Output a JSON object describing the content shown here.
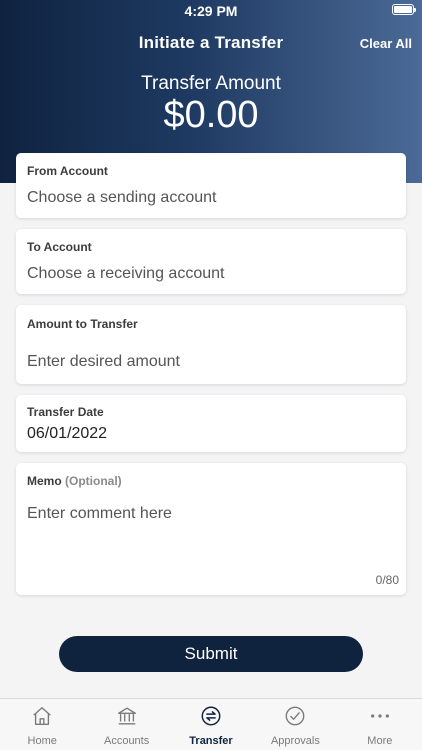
{
  "status_bar": {
    "time": "4:29 PM"
  },
  "header": {
    "title": "Initiate a Transfer",
    "clear_all": "Clear All",
    "amount_label": "Transfer Amount",
    "amount_value": "$0.00"
  },
  "form": {
    "from_account": {
      "label": "From Account",
      "placeholder": "Choose a sending account"
    },
    "to_account": {
      "label": "To Account",
      "placeholder": "Choose a receiving account"
    },
    "amount": {
      "label": "Amount to Transfer",
      "placeholder": "Enter desired amount"
    },
    "transfer_date": {
      "label": "Transfer Date",
      "value": "06/01/2022"
    },
    "memo": {
      "label": "Memo",
      "optional": "(Optional)",
      "placeholder": "Enter comment here",
      "counter": "0/80"
    },
    "submit_label": "Submit"
  },
  "tabbar": {
    "items": [
      {
        "label": "Home",
        "icon": "home-icon"
      },
      {
        "label": "Accounts",
        "icon": "bank-icon"
      },
      {
        "label": "Transfer",
        "icon": "transfer-icon",
        "active": true
      },
      {
        "label": "Approvals",
        "icon": "check-circle-icon"
      },
      {
        "label": "More",
        "icon": "more-icon"
      }
    ]
  },
  "colors": {
    "header_dark": "#0f2340",
    "header_light": "#4c6a97",
    "primary": "#10233e",
    "background": "#f4f4f5"
  }
}
